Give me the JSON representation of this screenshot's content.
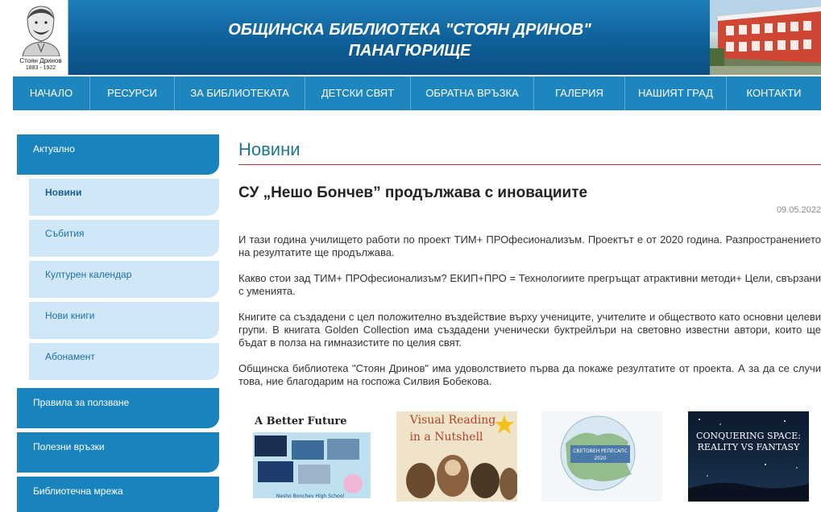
{
  "header": {
    "title_line1": "ОБЩИНСКА БИБЛИОТЕКА \"СТОЯН ДРИНОВ\"",
    "title_line2": "ПАНАГЮРИЩЕ",
    "portrait_caption": "Стоян Дринов",
    "portrait_years": "1883 - 1922"
  },
  "nav": {
    "items": [
      "НАЧАЛО",
      "РЕСУРСИ",
      "ЗА БИБЛИОТЕКАТА",
      "ДЕТСКИ СВЯТ",
      "ОБРАТНА ВРЪЗКА",
      "ГАЛЕРИЯ",
      "НАШИЯТ ГРАД",
      "КОНТАКТИ"
    ]
  },
  "sidebar": {
    "main_top": "Актуално",
    "sub_items": [
      "Новини",
      "Събития",
      "Културен календар",
      "Нови книги",
      "Абонамент"
    ],
    "main_items": [
      "Правила за ползване",
      "Полезни връзки",
      "Библиотечна мрежа"
    ]
  },
  "main": {
    "section_title": "Новини",
    "article_title": "СУ „Нешо Бончев” продължава с иновациите",
    "date": "09.05.2022",
    "paragraphs": [
      "И тази година училището работи по проект ТИМ+ ПРОфесионализъм. Проектът е от 2020 година. Разпространението на резултатите ще продължава.",
      "Какво стои зад ТИМ+ ПРОфесионализъм? ЕКИП+ПРО = Технологиите прегръщат атрактивни методи+ Цели, свързани с уменията.",
      "Книгите са създадени с цел положително въздействие върху учениците, учителите и обществото като основни целеви групи. В книгата Golden Collection има създадени ученически буктрейлъри на световно известни автори, които ще бъдат в полза на гимназистите по целия свят.",
      "Общинска библиотека \"Стоян Дринов\" има удоволствието първа да покаже резултатите от проекта. А за да се случи това, ние благодарим на госпожа Силвия Бобекова."
    ]
  },
  "thumbnails": [
    {
      "title": "A Better Future",
      "footer": "Nesho Bonchev High School"
    },
    {
      "title_line1": "Visual Reading",
      "title_line2": "in a Nutshell"
    },
    {
      "title_line1": "СВЕТОВЕН РЕПЕСАПС",
      "title_line2": "2020"
    },
    {
      "title_line1": "CONQUERING SPACE:",
      "title_line2": "REALITY VS FANTASY"
    }
  ],
  "colors": {
    "header_blue": "#0e5f98",
    "nav_blue": "#1d86bf",
    "sidebar_blue": "#1983bd",
    "sidebar_sub": "#cfe7f7",
    "section_title": "#1e7595",
    "rule_red": "#b33a3a"
  }
}
